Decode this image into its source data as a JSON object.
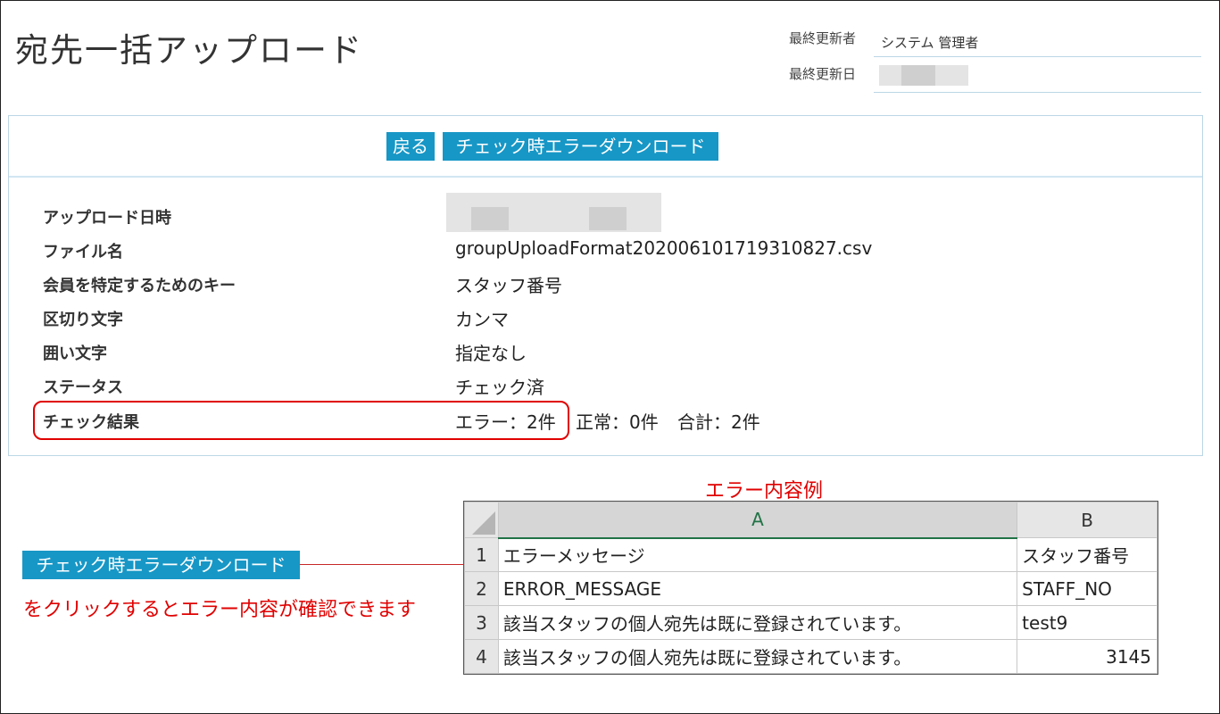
{
  "header": {
    "title": "宛先一括アップロード",
    "last_updated_by_label": "最終更新者",
    "last_updated_by_value": "システム 管理者",
    "last_updated_date_label": "最終更新日"
  },
  "toolbar": {
    "back_label": "戻る",
    "error_download_label": "チェック時エラーダウンロード"
  },
  "details": {
    "upload_datetime_label": "アップロード日時",
    "file_name_label": "ファイル名",
    "file_name_value": "groupUploadFormat202006101719310827.csv",
    "member_key_label": "会員を特定するためのキー",
    "member_key_value": "スタッフ番号",
    "delimiter_label": "区切り文字",
    "delimiter_value": "カンマ",
    "enclosure_label": "囲い文字",
    "enclosure_value": "指定なし",
    "status_label": "ステータス",
    "status_value": "チェック済",
    "check_result_label": "チェック結果",
    "check_result_error": "エラー：2件",
    "check_result_normal": "正常：0件",
    "check_result_total": "合計：2件"
  },
  "annotation": {
    "caption": "エラー内容例",
    "button_label": "チェック時エラーダウンロード",
    "note": "をクリックするとエラー内容が確認できます"
  },
  "spreadsheet": {
    "col_a": "A",
    "col_b": "B",
    "rows": [
      {
        "num": "1",
        "a": "エラーメッセージ",
        "b": "スタッフ番号"
      },
      {
        "num": "2",
        "a": "ERROR_MESSAGE",
        "b": "STAFF_NO"
      },
      {
        "num": "3",
        "a": "該当スタッフの個人宛先は既に登録されています。",
        "b": "test9"
      },
      {
        "num": "4",
        "a": "該当スタッフの個人宛先は既に登録されています。",
        "b": "3145"
      }
    ]
  },
  "colors": {
    "accent": "#1797c6",
    "highlight": "#e00000",
    "divider": "#bcd6e6"
  }
}
